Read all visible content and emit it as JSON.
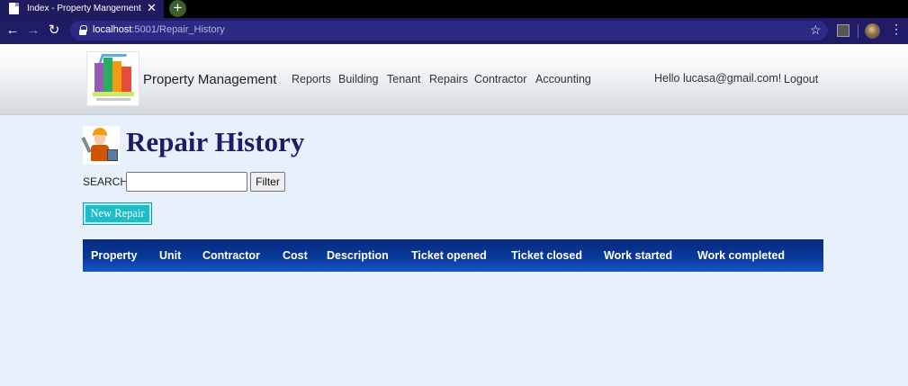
{
  "browser": {
    "tab_title": "Index - Property Mangement",
    "tab_close": "✕",
    "new_tab": "+",
    "url_host": "localhost",
    "url_path": ":5001/Repair_History",
    "icons": [
      "back-icon",
      "forward-icon",
      "reload-icon",
      "lock-icon",
      "star-icon",
      "extension-icon",
      "profile-avatar",
      "menu-icon"
    ]
  },
  "navbar": {
    "brand": "Property Management",
    "links": [
      "Reports",
      "Building",
      "Tenant",
      "Repairs",
      "Contractor",
      "Accounting"
    ],
    "greeting": "Hello lucasa@gmail.com!",
    "logout": "Logout"
  },
  "page": {
    "title": "Repair History",
    "search_label": "SEARCH:",
    "search_value": "",
    "filter_button": "Filter",
    "new_button": "New Repair"
  },
  "table": {
    "columns": [
      "Property",
      "Unit",
      "Contractor",
      "Cost",
      "Description",
      "Ticket opened",
      "Ticket closed",
      "Work started",
      "Work completed"
    ],
    "rows": []
  },
  "colors": {
    "browser_chrome": "#1f1b66",
    "heading": "#1f1b66",
    "new_button": "#1ebdc7",
    "table_header": "#0a3a9e",
    "page_background": "#e8f1fb"
  }
}
